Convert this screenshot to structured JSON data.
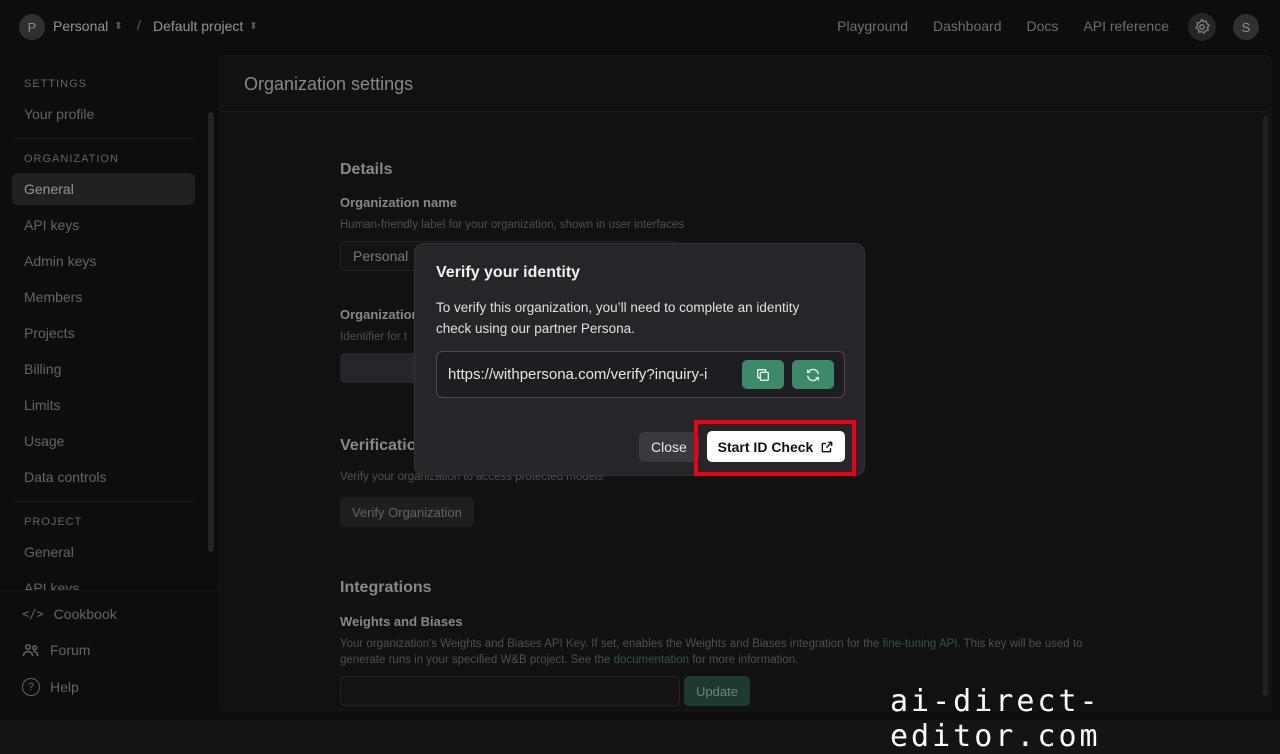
{
  "topbar": {
    "org_initial": "P",
    "org_name": "Personal",
    "separator": "/",
    "project_name": "Default project",
    "nav": [
      "Playground",
      "Dashboard",
      "Docs",
      "API reference"
    ],
    "settings_icon": "gear-icon",
    "user_initial": "S"
  },
  "sidebar": {
    "settings_heading": "SETTINGS",
    "your_profile": "Your profile",
    "organization_heading": "ORGANIZATION",
    "org_items": [
      "General",
      "API keys",
      "Admin keys",
      "Members",
      "Projects",
      "Billing",
      "Limits",
      "Usage",
      "Data controls"
    ],
    "active_item": "General",
    "project_heading": "PROJECT",
    "project_items": [
      "General",
      "API keys"
    ],
    "bottom": [
      {
        "label": "Cookbook",
        "icon": "code-icon"
      },
      {
        "label": "Forum",
        "icon": "people-icon"
      },
      {
        "label": "Help",
        "icon": "help-circle-icon"
      }
    ]
  },
  "main": {
    "title": "Organization settings",
    "details_heading": "Details",
    "org_name_label": "Organization name",
    "org_name_help": "Human-friendly label for your organization, shown in user interfaces",
    "org_name_value": "Personal",
    "org_id_label": "Organization",
    "org_id_help": "Identifier for t",
    "verification_heading": "Verificatio",
    "verification_help": "Verify your organization to access protected models",
    "verify_button": "Verify Organization",
    "integrations_heading": "Integrations",
    "wb_label": "Weights and Biases",
    "wb_help_1": "Your organization's Weights and Biases API Key. If set, enables the Weights and Biases integration for the ",
    "wb_help_link1": "fine-tuning API",
    "wb_help_2": ". This key will be used to",
    "wb_help_3": "generate runs in your specified W&B project. See the ",
    "wb_help_link2": "documentation",
    "wb_help_4": " for more information.",
    "update_button": "Update"
  },
  "modal": {
    "title": "Verify your identity",
    "body": "To verify this organization, you’ll need to complete an identity check using our partner Persona.",
    "url": "https://withpersona.com/verify?inquiry-i",
    "copy_icon": "copy-icon",
    "refresh_icon": "refresh-icon",
    "close_button": "Close",
    "start_button": "Start ID Check",
    "external_icon": "external-link-icon"
  },
  "colors": {
    "highlight": "#e8001a",
    "accent_green": "#3d8a6a"
  },
  "watermark": "ai-direct-editor.com"
}
